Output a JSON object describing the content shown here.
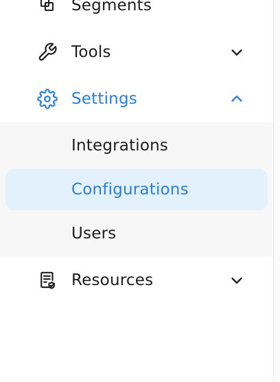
{
  "nav": {
    "segments": {
      "label": "Segments",
      "icon": "segments-icon"
    },
    "tools": {
      "label": "Tools",
      "icon": "wrench-icon",
      "chevron": "chevron-down-icon"
    },
    "settings": {
      "label": "Settings",
      "icon": "gear-icon",
      "chevron": "chevron-up-icon",
      "expanded": true,
      "children": [
        {
          "label": "Integrations",
          "selected": false
        },
        {
          "label": "Configurations",
          "selected": true
        },
        {
          "label": "Users",
          "selected": false
        }
      ]
    },
    "resources": {
      "label": "Resources",
      "icon": "document-check-icon",
      "chevron": "chevron-down-icon"
    }
  },
  "colors": {
    "accent": "#2b7fd4",
    "text": "#1d1d1d",
    "submenu_bg": "#f7f7f7",
    "selected_bg": "#e3f1fd"
  }
}
